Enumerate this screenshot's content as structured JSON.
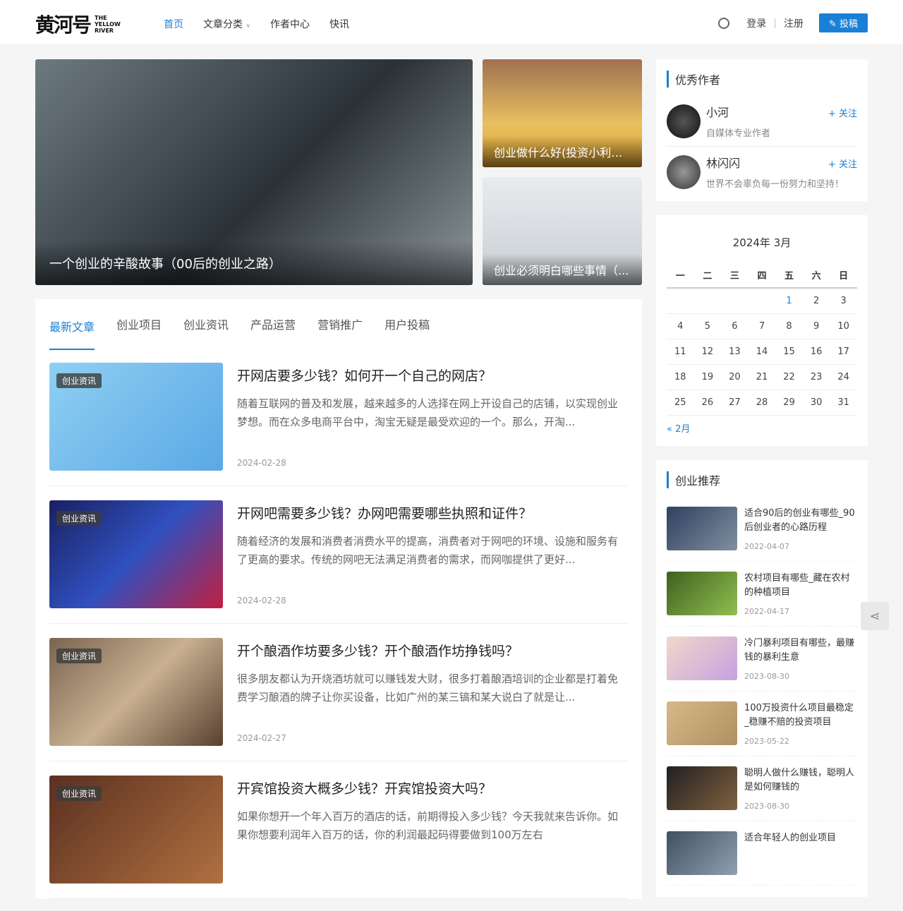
{
  "header": {
    "logo_cn": "黄河号",
    "logo_en": [
      "THE",
      "YELLOW",
      "RIVER"
    ],
    "nav": [
      "首页",
      "文章分类",
      "作者中心",
      "快讯"
    ],
    "login": "登录",
    "register": "注册",
    "submit": "投稿"
  },
  "hero": {
    "main": "一个创业的辛酸故事（00后的创业之路）",
    "side": [
      "创业做什么好(投资小利润...",
      "创业必须明白哪些事情（..."
    ]
  },
  "tabs": [
    "最新文章",
    "创业项目",
    "创业资讯",
    "产品运营",
    "营销推广",
    "用户投稿"
  ],
  "articles": [
    {
      "badge": "创业资讯",
      "title": "开网店要多少钱？如何开一个自己的网店？",
      "desc": "随着互联网的普及和发展，越来越多的人选择在网上开设自己的店铺，以实现创业梦想。而在众多电商平台中，淘宝无疑是最受欢迎的一个。那么，开淘...",
      "date": "2024-02-28"
    },
    {
      "badge": "创业资讯",
      "title": "开网吧需要多少钱？办网吧需要哪些执照和证件？",
      "desc": "随着经济的发展和消费者消费水平的提高，消费者对于网吧的环境、设施和服务有了更高的要求。传统的网吧无法满足消费者的需求，而网咖提供了更好...",
      "date": "2024-02-28"
    },
    {
      "badge": "创业资讯",
      "title": "开个酿酒作坊要多少钱？开个酿酒作坊挣钱吗？",
      "desc": "很多朋友都认为开烧酒坊就可以赚钱发大财，很多打着酿酒培训的企业都是打着免费学习酿酒的牌子让你买设备，比如广州的某三镐和某大说白了就是让...",
      "date": "2024-02-27"
    },
    {
      "badge": "创业资讯",
      "title": "开宾馆投资大概多少钱？开宾馆投资大吗？",
      "desc": "如果你想开一个年入百万的酒店的话，前期得投入多少钱？今天我就来告诉你。如果你想要利润年入百万的话，你的利润最起码得要做到100万左右",
      "date": ""
    }
  ],
  "authors": {
    "title": "优秀作者",
    "follow": "+ 关注",
    "items": [
      {
        "name": "小河",
        "desc": "自媒体专业作者"
      },
      {
        "name": "林闪闪",
        "desc": "世界不会辜负每一份努力和坚持！"
      }
    ]
  },
  "calendar": {
    "title": "2024年 3月",
    "weekdays": [
      "一",
      "二",
      "三",
      "四",
      "五",
      "六",
      "日"
    ],
    "prev": "« 2月"
  },
  "recommend": {
    "title": "创业推荐",
    "items": [
      {
        "title": "适合90后的创业有哪些_90后创业者的心路历程",
        "date": "2022-04-07"
      },
      {
        "title": "农村项目有哪些_藏在农村的种植项目",
        "date": "2022-04-17"
      },
      {
        "title": "冷门暴利项目有哪些，最赚钱的暴利生意",
        "date": "2023-08-30"
      },
      {
        "title": "100万投资什么项目最稳定_稳赚不赔的投资项目",
        "date": "2023-05-22"
      },
      {
        "title": "聪明人做什么赚钱，聪明人是如何赚钱的",
        "date": "2023-08-30"
      },
      {
        "title": "适合年轻人的创业项目",
        "date": ""
      }
    ]
  }
}
